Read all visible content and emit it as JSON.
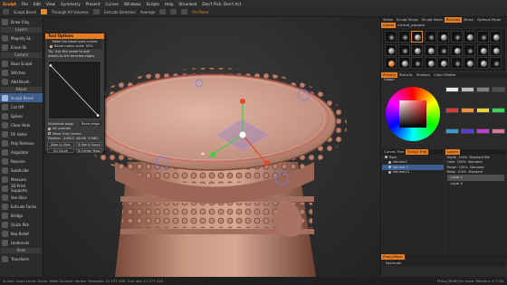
{
  "menubar": {
    "logo": "Sculpt",
    "items": [
      "File",
      "Edit",
      "View",
      "Symmetry",
      "Present",
      "Curves",
      "Windows",
      "Scripts",
      "Help",
      "Shrunked",
      "Don't Pick, Don't Act"
    ]
  },
  "toolbar": {
    "items": [
      "Sculpt Bevel",
      "Through All Volumes",
      "Extrude Direction",
      "Average",
      "On Plane"
    ]
  },
  "left_tools": {
    "header": "Layers",
    "items": [
      {
        "label": "Draw Clay",
        "active": false
      },
      {
        "label": "Magnify Sk",
        "active": false
      },
      {
        "label": "Erase Sk",
        "active": false
      },
      {
        "label": "Custom",
        "active": false
      },
      {
        "label": "Base Sculpt",
        "active": false
      },
      {
        "label": "Stitches",
        "active": false
      },
      {
        "label": "Add Brush",
        "active": false
      },
      {
        "label": "Adjust",
        "active": false
      },
      {
        "label": "Sculpt Bevel",
        "active": true
      },
      {
        "label": "Cut Off",
        "active": false
      },
      {
        "label": "Spikes",
        "active": false
      },
      {
        "label": "Close Hole",
        "active": false
      },
      {
        "label": "Fill Holes",
        "active": false
      },
      {
        "label": "Poly Remove",
        "active": false
      },
      {
        "label": "Angulator",
        "active": false
      },
      {
        "label": "Resolve",
        "active": false
      },
      {
        "label": "Subdivide",
        "active": false
      },
      {
        "label": "Measure",
        "active": false
      },
      {
        "label": "3D Print Supports",
        "active": false
      },
      {
        "label": "Vox Slice",
        "active": false
      },
      {
        "label": "Extrude Faces",
        "active": false
      },
      {
        "label": "Bridge",
        "active": false
      },
      {
        "label": "Quick Pick",
        "active": false
      },
      {
        "label": "Key-Relief",
        "active": false
      },
      {
        "label": "Undercuts",
        "active": false
      },
      {
        "label": "Pose",
        "active": false
      },
      {
        "label": "Transform",
        "active": false
      }
    ]
  },
  "popup": {
    "title": "Tool Options",
    "lines": [
      "Make the bevel over curves",
      "Bevel radius scale",
      "Tip: Use this panel to add",
      "details to the beveled edges."
    ],
    "radius_value": "50%",
    "checks": [
      {
        "label": "Subdivide edge",
        "value": "Bevel edge",
        "on": false
      },
      {
        "label": "All controls",
        "on": true
      },
      {
        "label": "Move Only Gizmo",
        "on": false
      }
    ],
    "position_label": "Position",
    "position_values": [
      "-40003",
      "44030",
      "22982"
    ],
    "buttons": [
      [
        "Align to View",
        "To World Space"
      ],
      [
        "On Curve",
        "To Center Mass"
      ]
    ]
  },
  "statusbar": {
    "left": "Sculpt: Scale Layer: Scale, Mesh Surface: Vertex, Triangles: 12 277 440, Curr obj: 12 277 440",
    "right": "Press [Shift] for more. Memory: 4 7 Gb"
  },
  "right_panel": {
    "top_tabs": [
      "Strips",
      "Sculpt Strips",
      "Sculpt Mesh",
      "Brushes",
      "Brush",
      "Options Panel"
    ],
    "active_top_tab": 3,
    "sub_tabs": [
      "Global",
      "Artmat_parpack"
    ],
    "material_count": 27,
    "mid_tabs": [
      "Presets",
      "Stencils",
      "Shaders",
      "Color Palette"
    ],
    "active_mid_tab": 0,
    "global_label": "Global",
    "swatch_colors": [
      "#e8e8e8",
      "#b9b9b9",
      "#808080",
      "#4d4d4d",
      "#d43a3a",
      "#e8923a",
      "#e8d43a",
      "#3ad45a",
      "#3a9ad4",
      "#5a3ad4",
      "#c43ad4",
      "#d47aa0"
    ],
    "scene_tabs": [
      "Curves Tree",
      "Sculpt Tree"
    ],
    "active_scene_tab": 1,
    "tree": [
      {
        "label": "Root",
        "level": 0,
        "sel": false
      },
      {
        "label": "Volume2",
        "level": 1,
        "sel": false
      },
      {
        "label": "Volume 1",
        "level": 1,
        "sel": true
      },
      {
        "label": "Volume13",
        "level": 1,
        "sel": false
      }
    ],
    "layers_tab": "Layers",
    "layer_rows": [
      {
        "a": "Depth",
        "b": "100%",
        "c": "Standard Ble"
      },
      {
        "a": "Color",
        "b": "100%",
        "c": "Standard"
      },
      {
        "a": "Rough",
        "b": "100%",
        "c": "Standard"
      },
      {
        "a": "Metal",
        "b": "100%",
        "c": "Standard"
      }
    ],
    "layer_items": [
      {
        "label": "Layer 1",
        "sel": true
      },
      {
        "label": "Layer 0",
        "sel": false
      }
    ],
    "props_tab": "Proxy/Mesh",
    "props_value": "Decimate"
  }
}
